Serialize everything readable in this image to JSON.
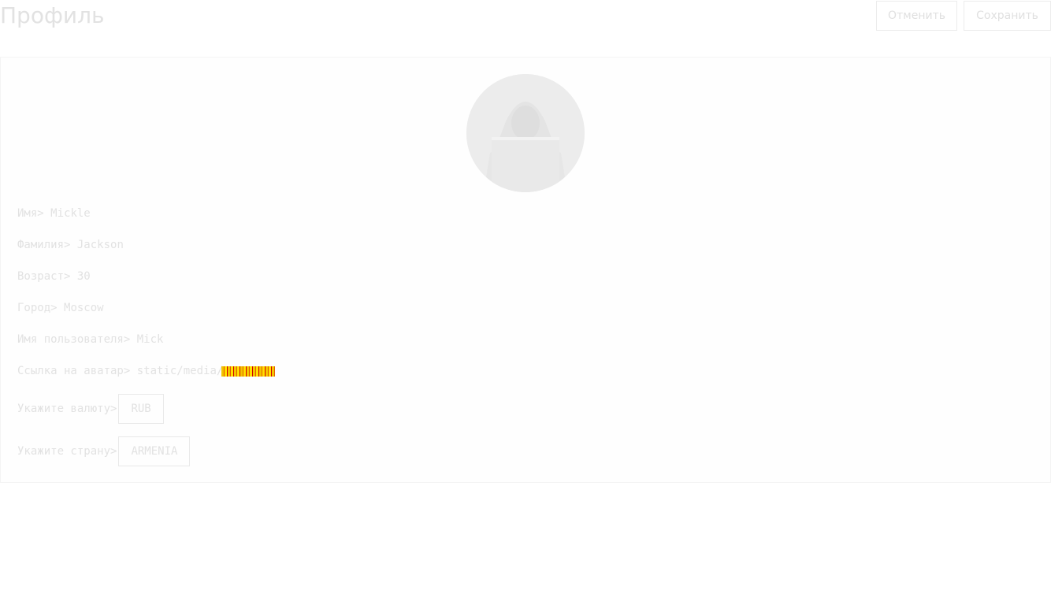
{
  "header": {
    "title": "Профиль",
    "cancel_label": "Отменить",
    "save_label": "Сохранить"
  },
  "profile": {
    "avatar_icon": "hooded-figure-avatar",
    "fields": {
      "first_name": {
        "label": "Имя>",
        "value": "Mickle"
      },
      "last_name": {
        "label": "Фамилия>",
        "value": "Jackson"
      },
      "age": {
        "label": "Возраст>",
        "value": "30"
      },
      "city": {
        "label": "Город>",
        "value": "Moscow"
      },
      "username": {
        "label": "Имя пользователя>",
        "value": "Mick"
      },
      "avatar_link": {
        "label": "Ссылка на аватар>",
        "value": "static/media/"
      },
      "currency": {
        "label": "Укажите валюту>",
        "value": "RUB"
      },
      "country": {
        "label": "Укажите страну>",
        "value": "ARMENIA"
      }
    }
  },
  "colors": {
    "text": "#e2e2e2",
    "border": "#ececec",
    "background": "#ffffff"
  }
}
